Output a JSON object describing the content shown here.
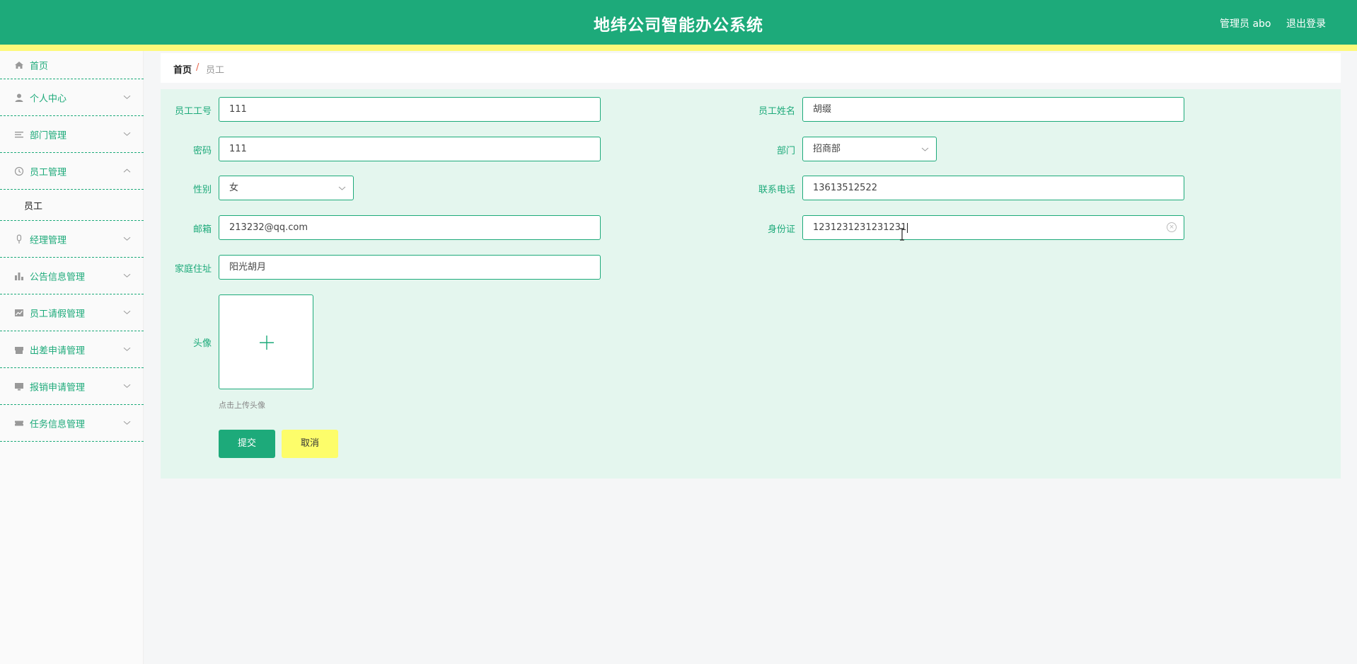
{
  "header": {
    "title": "地纬公司智能办公系统",
    "user_label": "管理员 abo",
    "logout_label": "退出登录"
  },
  "sidebar": {
    "items": [
      {
        "label": "首页",
        "icon": "home-icon"
      },
      {
        "label": "个人中心",
        "icon": "user-icon"
      },
      {
        "label": "部门管理",
        "icon": "list-icon"
      },
      {
        "label": "员工管理",
        "icon": "clock-icon"
      },
      {
        "label": "经理管理",
        "icon": "mic-icon"
      },
      {
        "label": "公告信息管理",
        "icon": "bar-chart-icon"
      },
      {
        "label": "员工请假管理",
        "icon": "line-chart-icon"
      },
      {
        "label": "出差申请管理",
        "icon": "shop-icon"
      },
      {
        "label": "报销申请管理",
        "icon": "monitor-icon"
      },
      {
        "label": "任务信息管理",
        "icon": "ticket-icon"
      }
    ],
    "sub_item": "员工"
  },
  "breadcrumb": {
    "home": "首页",
    "separator": "/",
    "current": "员工"
  },
  "form": {
    "employee_no": {
      "label": "员工工号",
      "value": "111"
    },
    "employee_name": {
      "label": "员工姓名",
      "value": "胡缀"
    },
    "password": {
      "label": "密码",
      "value": "111"
    },
    "department": {
      "label": "部门",
      "value": "招商部"
    },
    "gender": {
      "label": "性别",
      "value": "女"
    },
    "phone": {
      "label": "联系电话",
      "value": "13613512522"
    },
    "email": {
      "label": "邮箱",
      "value": "213232@qq.com"
    },
    "id_card": {
      "label": "身份证",
      "value": "1231231231231231"
    },
    "address": {
      "label": "家庭住址",
      "value": "阳光胡月"
    },
    "avatar": {
      "label": "头像",
      "hint": "点击上传头像"
    },
    "submit_label": "提交",
    "cancel_label": "取消"
  },
  "colors": {
    "primary": "#1daa7a",
    "accent_yellow": "#fdf97a",
    "panel_bg": "#e4f6ee",
    "breadcrumb_sep": "#e7654b"
  }
}
